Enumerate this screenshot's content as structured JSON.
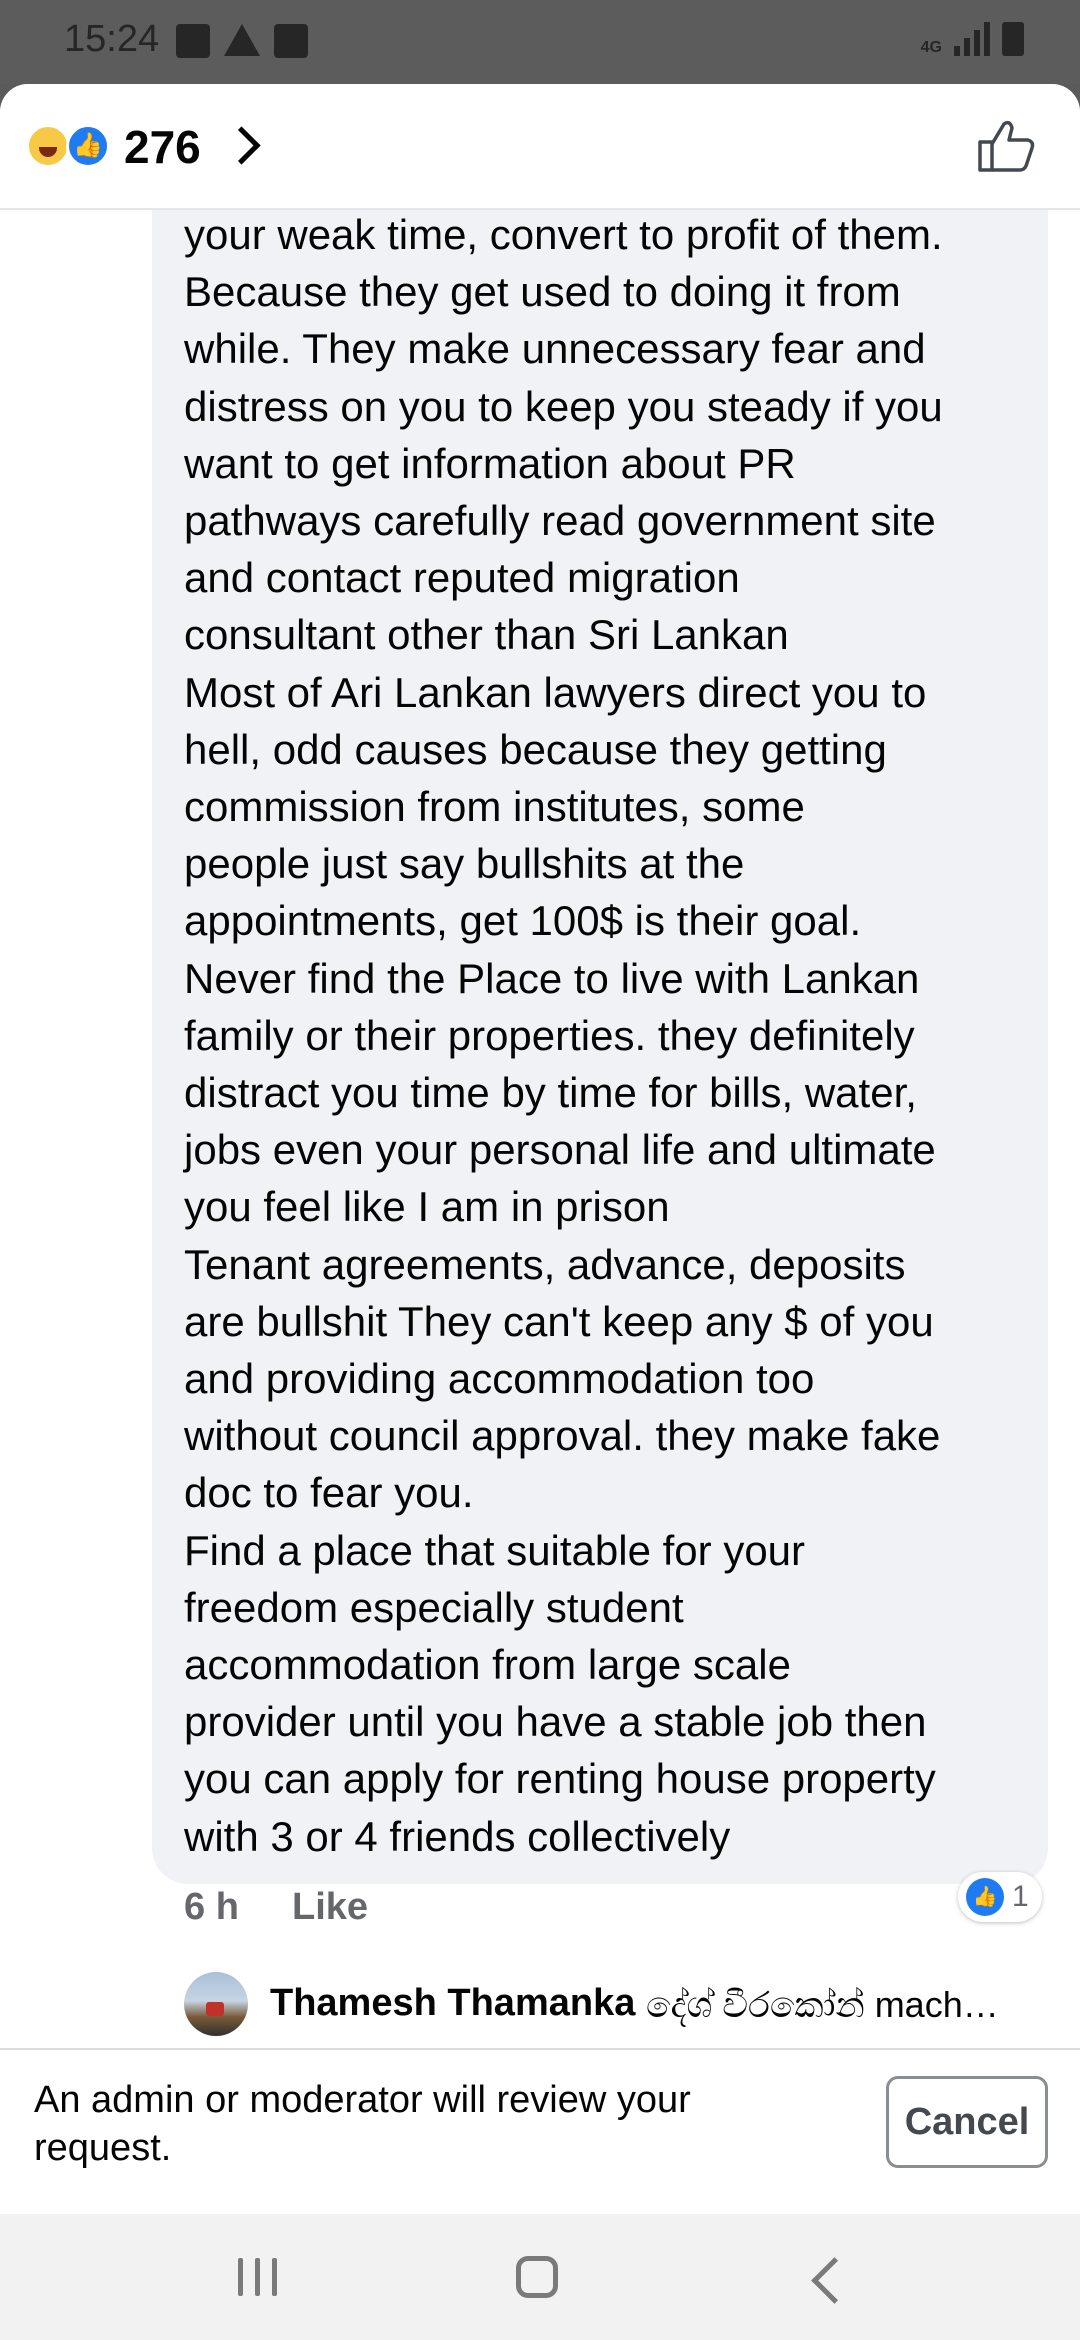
{
  "status_bar": {
    "time": "15:24",
    "network": "4G"
  },
  "header": {
    "reaction_count": "276",
    "reactions": [
      "haha-icon",
      "like-icon"
    ]
  },
  "comment": {
    "partial_top_line": "...",
    "text": "your weak time, convert to profit of them.\nBecause they get used to doing it from\nwhile. They make unnecessary fear and\ndistress on you to keep you steady if you\nwant to get information about PR\npathways carefully read government site\nand contact reputed migration\nconsultant other than Sri Lankan\nMost of Ari Lankan lawyers direct you to\nhell, odd causes because they getting\ncommission from institutes, some\npeople just say bullshits at the\nappointments, get 100$ is their goal.\nNever find the Place to live with Lankan\nfamily or their properties. they definitely\ndistract you time by time for bills, water,\njobs even your personal life  and ultimate\nyou feel like I am in prison\nTenant agreements, advance, deposits\nare bullshit They can't keep any $ of you\nand providing accommodation too\nwithout council approval. they make fake\ndoc to fear you.\nFind a place that suitable for your\nfreedom especially student\naccommodation from large scale\nprovider until you have a stable job then\nyou can apply for renting house property\nwith 3 or 4 friends collectively",
    "time": "6 h",
    "like_label": "Like",
    "reaction_count": "1"
  },
  "reply": {
    "name": "Thamesh Thamanka",
    "tag": "දේශ් වීරකෝන් mach…"
  },
  "notice": {
    "text": "An admin or moderator will review your request.",
    "cancel_label": "Cancel"
  },
  "colors": {
    "accent": "#1f7bf2",
    "bubble": "#f0f2f5",
    "meta_text": "#65676b"
  }
}
